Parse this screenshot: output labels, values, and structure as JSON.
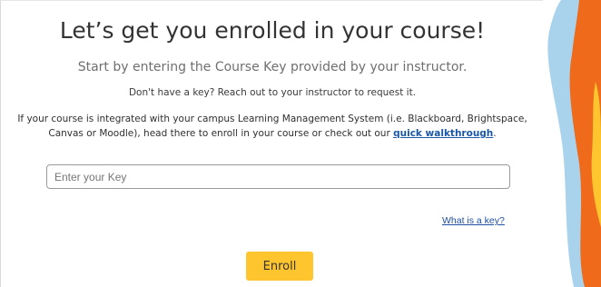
{
  "title": "Let’s get you enrolled in your course!",
  "subtitle": "Start by entering the Course Key provided by your instructor.",
  "no_key_text": "Don't have a key? Reach out to your instructor to request it.",
  "lms_text_before": "If your course is integrated with your campus Learning Management System (i.e. Blackboard, Brightspace, Canvas or Moodle), head there to enroll in your course or check out our ",
  "lms_link": "quick walkthrough",
  "lms_text_after": ".",
  "key_input": {
    "placeholder": "Enter your Key",
    "value": ""
  },
  "what_is_key_link": "What is a key?",
  "enroll_button": "Enroll",
  "colors": {
    "link": "#1a57a6",
    "button": "#ffc52e",
    "deco_blue": "#a9d3ec",
    "deco_orange": "#ef6a1b",
    "deco_yellow": "#ffc52e"
  }
}
